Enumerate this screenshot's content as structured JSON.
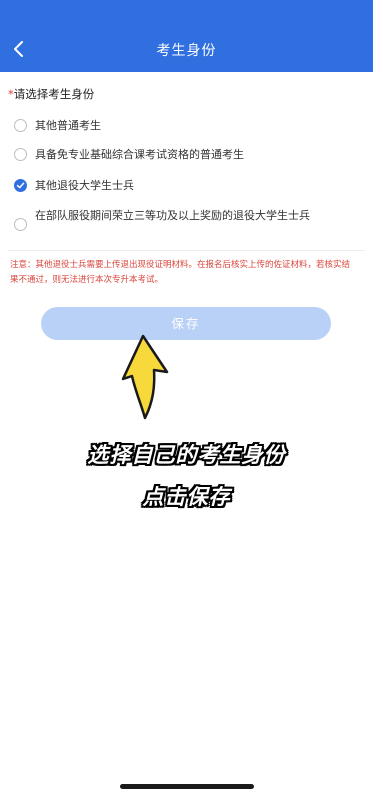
{
  "header": {
    "title": "考生身份"
  },
  "form": {
    "required_mark": "*",
    "label": "请选择考生身份",
    "options": [
      {
        "label": "其他普通考生",
        "checked": false
      },
      {
        "label": "具备免专业基础综合课考试资格的普通考生",
        "checked": false
      },
      {
        "label": "其他退役大学生士兵",
        "checked": true
      },
      {
        "label": "在部队服役期间荣立三等功及以上奖励的退役大学生士兵",
        "checked": false
      }
    ],
    "notice": "注意：其他退役士兵需要上传退出现役证明材料。在报名后核实上传的佐证材料，若核实结果不通过，则无法进行本次专升本考试。",
    "save_label": "保存"
  },
  "overlay": {
    "caption_line1": "选择自己的考生身份",
    "caption_line2": "点击保存"
  },
  "colors": {
    "primary": "#2f6fe0",
    "save_button_bg": "#b9d1f6",
    "notice_text": "#d9463d",
    "arrow_fill": "#f7d93b"
  }
}
